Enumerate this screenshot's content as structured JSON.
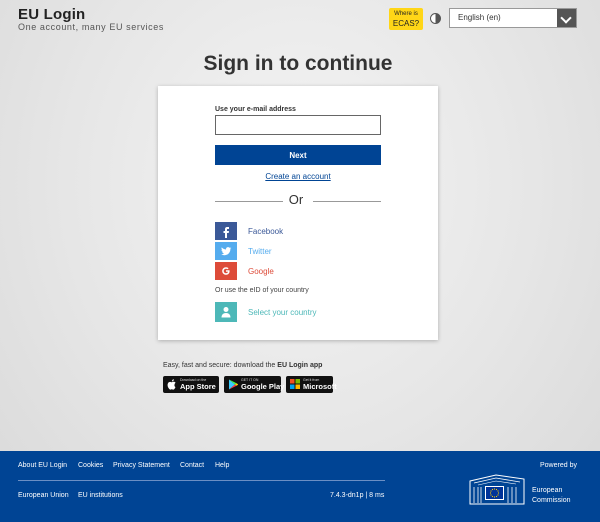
{
  "header": {
    "brand_title": "EU Login",
    "brand_subtitle": "One account, many EU services",
    "ecas_line1": "Where is",
    "ecas_line2": "ECAS?",
    "language": "English (en)"
  },
  "main": {
    "heading": "Sign in to continue",
    "email_label": "Use your e-mail address",
    "email_value": "",
    "email_placeholder": "",
    "next_label": "Next",
    "create_account": "Create an account",
    "or_label": "Or",
    "social": [
      {
        "name": "Facebook",
        "color": "#3b5998",
        "icon": "facebook-icon"
      },
      {
        "name": "Twitter",
        "color": "#55acee",
        "icon": "twitter-icon"
      },
      {
        "name": "Google",
        "color": "#dd4b39",
        "icon": "google-icon"
      }
    ],
    "eid_text": "Or use the eID of your country",
    "country_label": "Select your country",
    "country_color": "#4db8b8"
  },
  "apps": {
    "prefix": "Easy, fast and secure: download the ",
    "app_name": "EU Login app",
    "stores": [
      {
        "small": "Download on the",
        "big": "App Store",
        "icon": "apple-icon"
      },
      {
        "small": "GET IT ON",
        "big": "Google Play",
        "icon": "google-play-icon"
      },
      {
        "small": "Get it from",
        "big": "Microsoft",
        "icon": "microsoft-icon"
      }
    ]
  },
  "footer": {
    "links": [
      "About EU Login",
      "Cookies",
      "Privacy Statement",
      "Contact",
      "Help"
    ],
    "powered_by": "Powered by",
    "bottom_links": [
      "European Union",
      "EU institutions"
    ],
    "version": "7.4.3-dn1p | 8 ms",
    "org_line1": "European",
    "org_line2": "Commission"
  },
  "colors": {
    "brand_blue": "#004494",
    "ecas_yellow": "#ffd617"
  }
}
